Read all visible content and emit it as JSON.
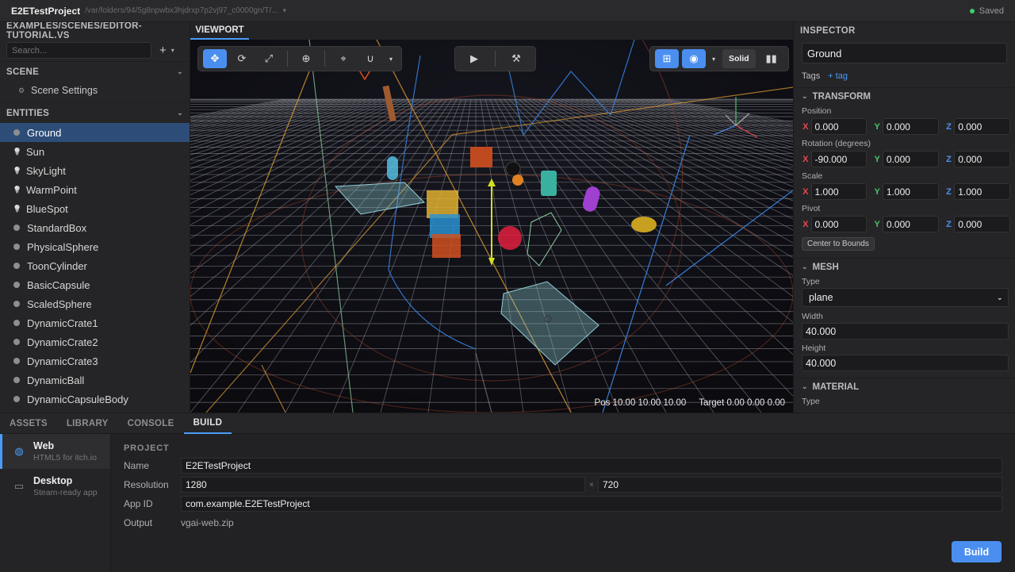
{
  "titlebar": {
    "title": "E2ETestProject",
    "path": "/var/folders/94/5g8npwbx3hjdrxp7p2vj97_c0000gn/T/...",
    "saved": "Saved"
  },
  "left": {
    "scene_path": "EXAMPLES/SCENES/EDITOR-TUTORIAL.VS",
    "search_placeholder": "Search...",
    "scene_header": "SCENE",
    "scene_settings": "Scene Settings",
    "entities_header": "ENTITIES",
    "entities": [
      "Ground",
      "Sun",
      "SkyLight",
      "WarmPoint",
      "BlueSpot",
      "StandardBox",
      "PhysicalSphere",
      "ToonCylinder",
      "BasicCapsule",
      "ScaledSphere",
      "DynamicCrate1",
      "DynamicCrate2",
      "DynamicCrate3",
      "DynamicBall",
      "DynamicCapsuleBody"
    ],
    "selected": "Ground"
  },
  "viewport": {
    "tab": "VIEWPORT",
    "solid": "Solid",
    "pos": "Pos 10.00 10.00 10.00",
    "target": "Target 0.00 0.00 0.00"
  },
  "inspector": {
    "header": "INSPECTOR",
    "name": "Ground",
    "tags_label": "Tags",
    "tag_add": "+ tag",
    "transform_header": "TRANSFORM",
    "position_label": "Position",
    "position": [
      "0.000",
      "0.000",
      "0.000"
    ],
    "rotation_label": "Rotation (degrees)",
    "rotation": [
      "-90.000",
      "0.000",
      "0.000"
    ],
    "scale_label": "Scale",
    "scale": [
      "1.000",
      "1.000",
      "1.000"
    ],
    "pivot_label": "Pivot",
    "pivot": [
      "0.000",
      "0.000",
      "0.000"
    ],
    "center_bounds": "Center to Bounds",
    "mesh_header": "MESH",
    "type_label": "Type",
    "mesh_type": "plane",
    "width_label": "Width",
    "width": "40.000",
    "height_label": "Height",
    "height": "40.000",
    "material_header": "MATERIAL",
    "material_type_label": "Type",
    "axes": [
      "X",
      "Y",
      "Z"
    ]
  },
  "bottom": {
    "tabs": [
      "ASSETS",
      "LIBRARY",
      "CONSOLE",
      "BUILD"
    ],
    "active_tab": "BUILD",
    "targets": [
      {
        "name": "Web",
        "sub": "HTML5 for itch.io"
      },
      {
        "name": "Desktop",
        "sub": "Steam-ready app"
      }
    ],
    "project_label": "PROJECT",
    "name_label": "Name",
    "name": "E2ETestProject",
    "resolution_label": "Resolution",
    "res_w": "1280",
    "res_x": "×",
    "res_h": "720",
    "appid_label": "App ID",
    "appid": "com.example.E2ETestProject",
    "output_label": "Output",
    "output": "vgai-web.zip",
    "build_button": "Build"
  },
  "colors": {
    "accent": "#4a8ff0",
    "selection": "#2d4d78",
    "saved": "#3ccf6b",
    "axis_x": "#e5484d",
    "axis_y": "#4ac26b",
    "axis_z": "#4a8ff0"
  }
}
